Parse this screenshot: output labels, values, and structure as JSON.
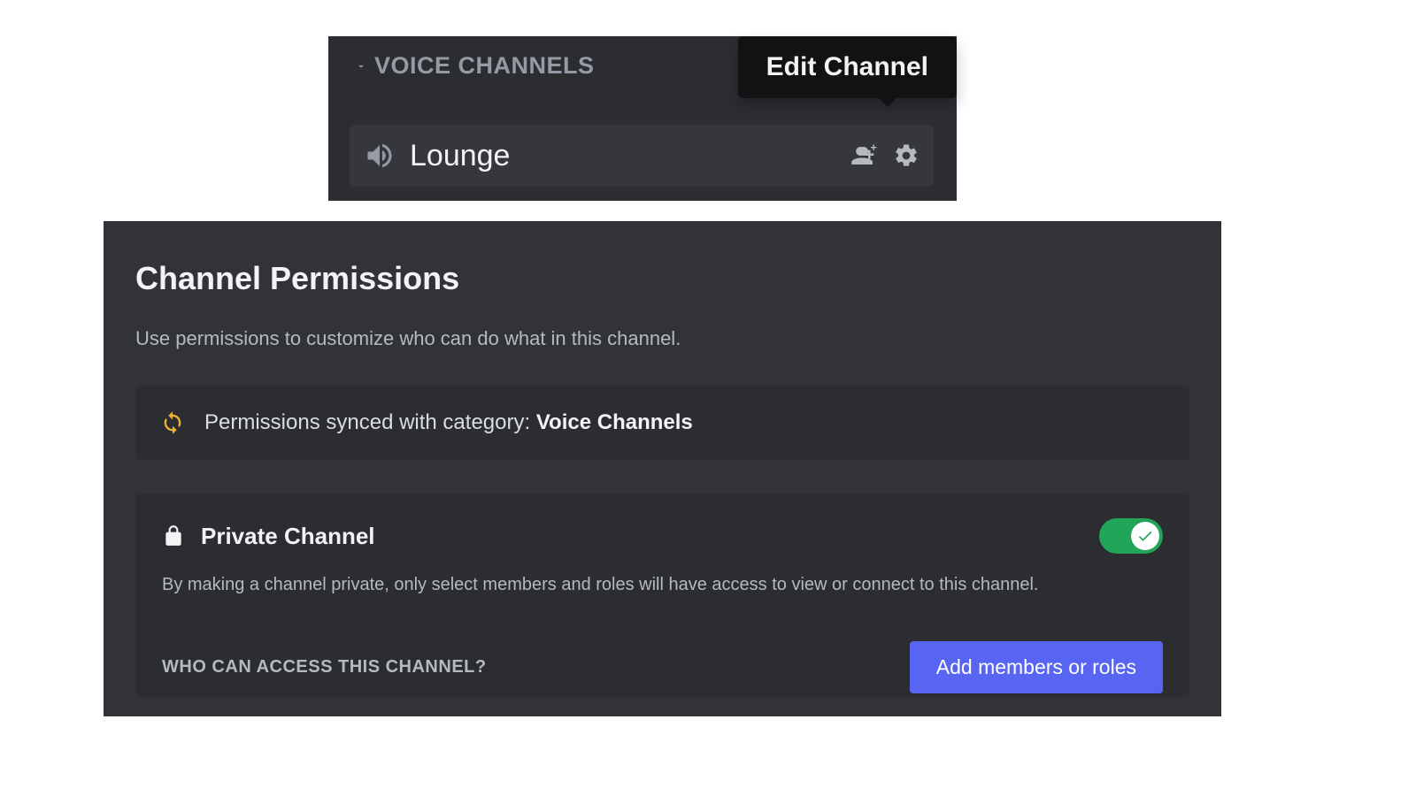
{
  "sidebar": {
    "category_label": "VOICE CHANNELS",
    "channel_name": "Lounge",
    "tooltip": "Edit Channel"
  },
  "permissions": {
    "title": "Channel Permissions",
    "subtitle": "Use permissions to customize who can do what in this channel.",
    "sync_prefix": "Permissions synced with category: ",
    "sync_category": "Voice Channels",
    "private": {
      "title": "Private Channel",
      "description": "By making a channel private, only select members and roles will have access to view or connect to this channel.",
      "enabled": true
    },
    "access_label": "WHO CAN ACCESS THIS CHANNEL?",
    "add_button": "Add members or roles"
  },
  "colors": {
    "bg_dark": "#2b2d31",
    "bg_darker": "#313338",
    "accent": "#5865f2",
    "success": "#23a559",
    "sync_icon": "#f0b232"
  }
}
